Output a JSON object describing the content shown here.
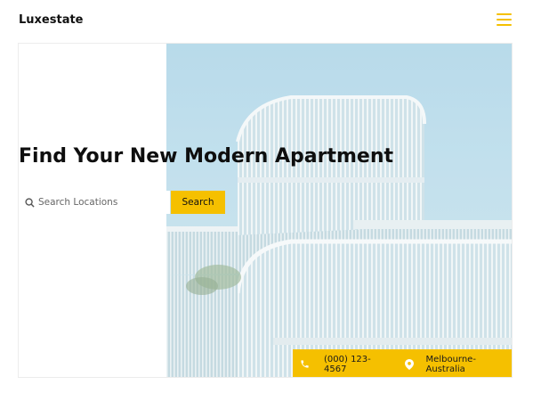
{
  "header": {
    "brand": "Luxestate",
    "menu_icon": "hamburger-menu-icon",
    "accent": "#f5c000"
  },
  "hero": {
    "headline": "Find Your New Modern Apartment",
    "image": "modern-apartment-building-photo"
  },
  "search": {
    "icon": "search-icon",
    "placeholder": "Search Locations",
    "value": "",
    "button_label": "Search"
  },
  "contact": {
    "phone_icon": "phone-icon",
    "phone": "(000) 123-4567",
    "location_icon": "map-pin-icon",
    "location": "Melbourne-Australia"
  }
}
